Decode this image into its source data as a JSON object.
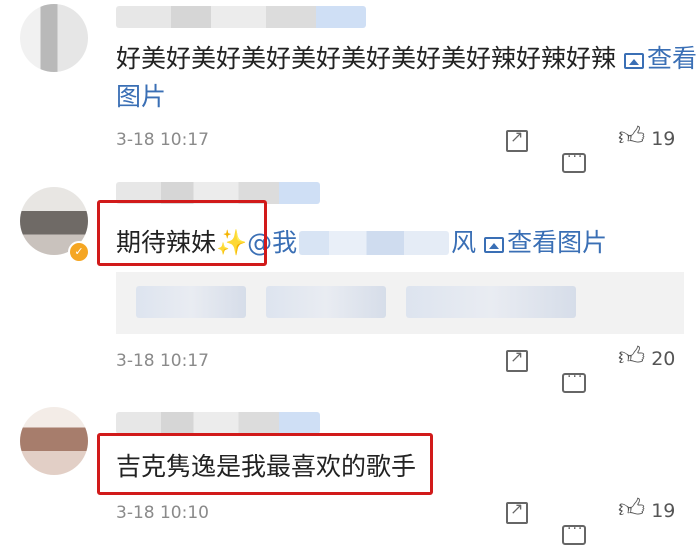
{
  "comments": [
    {
      "text": "好美好美好美好美好美好美好美好辣好辣好辣",
      "view_image": "查看",
      "view_image_line2": "图片",
      "time": "3-18 10:17",
      "likes": "19"
    },
    {
      "text": "期待辣妹",
      "sparkle": "✨",
      "mention_prefix": "@我",
      "mention_suffix": "风",
      "view_image": "查看图片",
      "time": "3-18 10:17",
      "likes": "20"
    },
    {
      "text": "吉克隽逸是我最喜欢的歌手",
      "time": "3-18 10:10",
      "likes": "19"
    }
  ],
  "icons": {
    "share": "share-icon",
    "comment": "comment-icon",
    "like": "thumbs-up-icon",
    "verified": "verified-badge-icon",
    "image": "image-icon"
  },
  "colors": {
    "link": "#3a6fb5",
    "highlight": "#d11a1a",
    "meta": "#8a8a8a"
  }
}
